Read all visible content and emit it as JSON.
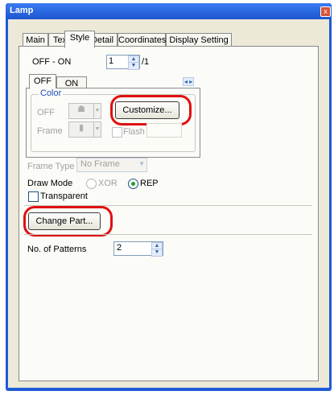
{
  "window": {
    "title": "Lamp",
    "close_label": "x"
  },
  "tabs": [
    {
      "label": "Main"
    },
    {
      "label": "Text"
    },
    {
      "label": "Style"
    },
    {
      "label": "Detail"
    },
    {
      "label": "Coordinates"
    },
    {
      "label": "Display Setting"
    }
  ],
  "style": {
    "off_on_label": "OFF - ON",
    "state_value": "1",
    "state_total": "/1",
    "state_tabs": [
      {
        "label": "OFF"
      },
      {
        "label": "ON"
      }
    ],
    "nav_arrows": "◂ ▸",
    "color_group": {
      "title": "Color",
      "off_label": "OFF",
      "frame_label": "Frame",
      "customize_label": "Customize...",
      "flash_label": "Flash"
    },
    "frame_type": {
      "label": "Frame Type",
      "value": "No Frame"
    },
    "draw_mode": {
      "label": "Draw Mode",
      "options": [
        "XOR",
        "REP"
      ],
      "selected": "REP"
    },
    "transparent_label": "Transparent",
    "change_part_label": "Change Part...",
    "patterns": {
      "label": "No. of Patterns",
      "value": "2"
    }
  }
}
